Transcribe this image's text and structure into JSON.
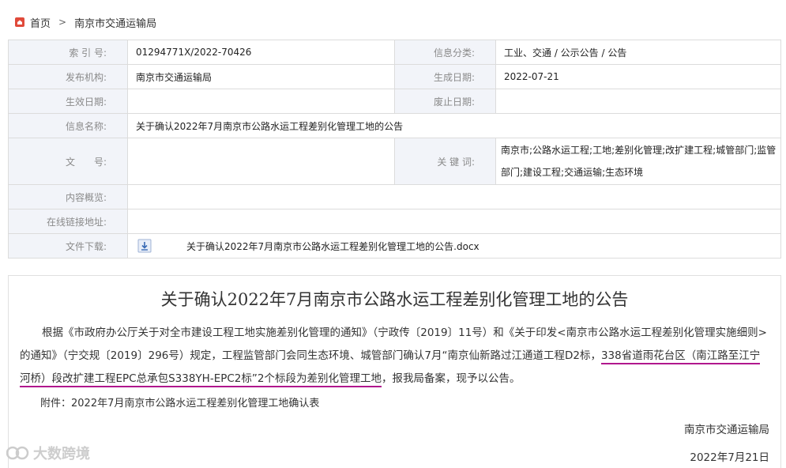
{
  "breadcrumb": {
    "home": "首页",
    "separator": ">",
    "current": "南京市交通运输局"
  },
  "meta": {
    "index_label": "索 引 号:",
    "index_value": "01294771X/2022-70426",
    "category_label": "信息分类:",
    "category_value": "工业、交通 / 公示公告 / 公告",
    "publisher_label": "发布机构:",
    "publisher_value": "南京市交通运输局",
    "gen_date_label": "生成日期:",
    "gen_date_value": "2022-07-21",
    "effective_label": "生效日期:",
    "effective_value": "",
    "abolish_label": "废止日期:",
    "abolish_value": "",
    "name_label": "信息名称:",
    "name_value": "关于确认2022年7月南京市公路水运工程差别化管理工地的公告",
    "docno_label": "文　　号:",
    "docno_value": "",
    "keywords_label": "关 键 词:",
    "keywords_value": "南京市;公路水运工程;工地;差别化管理;改扩建工程;城管部门;监管部门;建设工程;交通运输;生态环境",
    "summary_label": "内容概览:",
    "summary_value": "",
    "link_label": "在线链接地址:",
    "link_value": "",
    "download_label": "文件下载:",
    "download_file": "关于确认2022年7月南京市公路水运工程差别化管理工地的公告.docx"
  },
  "article": {
    "title": "关于确认2022年7月南京市公路水运工程差别化管理工地的公告",
    "body_part1": "根据《市政府办公厅关于对全市建设工程工地实施差别化管理的通知》（宁政传〔2019〕11号）和《关于印发<南京市公路水运工程差别化管理实施细则>的通知》（宁交规〔2019〕296号）规定，工程监管部门会同生态环境、城管部门确认7月“南京仙新路过江通道工程D2标，",
    "body_highlight": "338省道雨花台区（南江路至江宁河桥）段改扩建工程EPC总承包S338YH-EPC2标”2个标段为差别化管理工地",
    "body_part2": "，报我局备案，现予以公告。",
    "attachment": "附件：2022年7月南京市公路水运工程差别化管理工地确认表",
    "signature": "南京市交通运输局",
    "date": "2022年7月21日"
  },
  "watermark": "大数跨境",
  "colors": {
    "label_bg": "#f2f4f9",
    "border": "#dcdcdc",
    "highlight_underline": "#b0178d"
  }
}
